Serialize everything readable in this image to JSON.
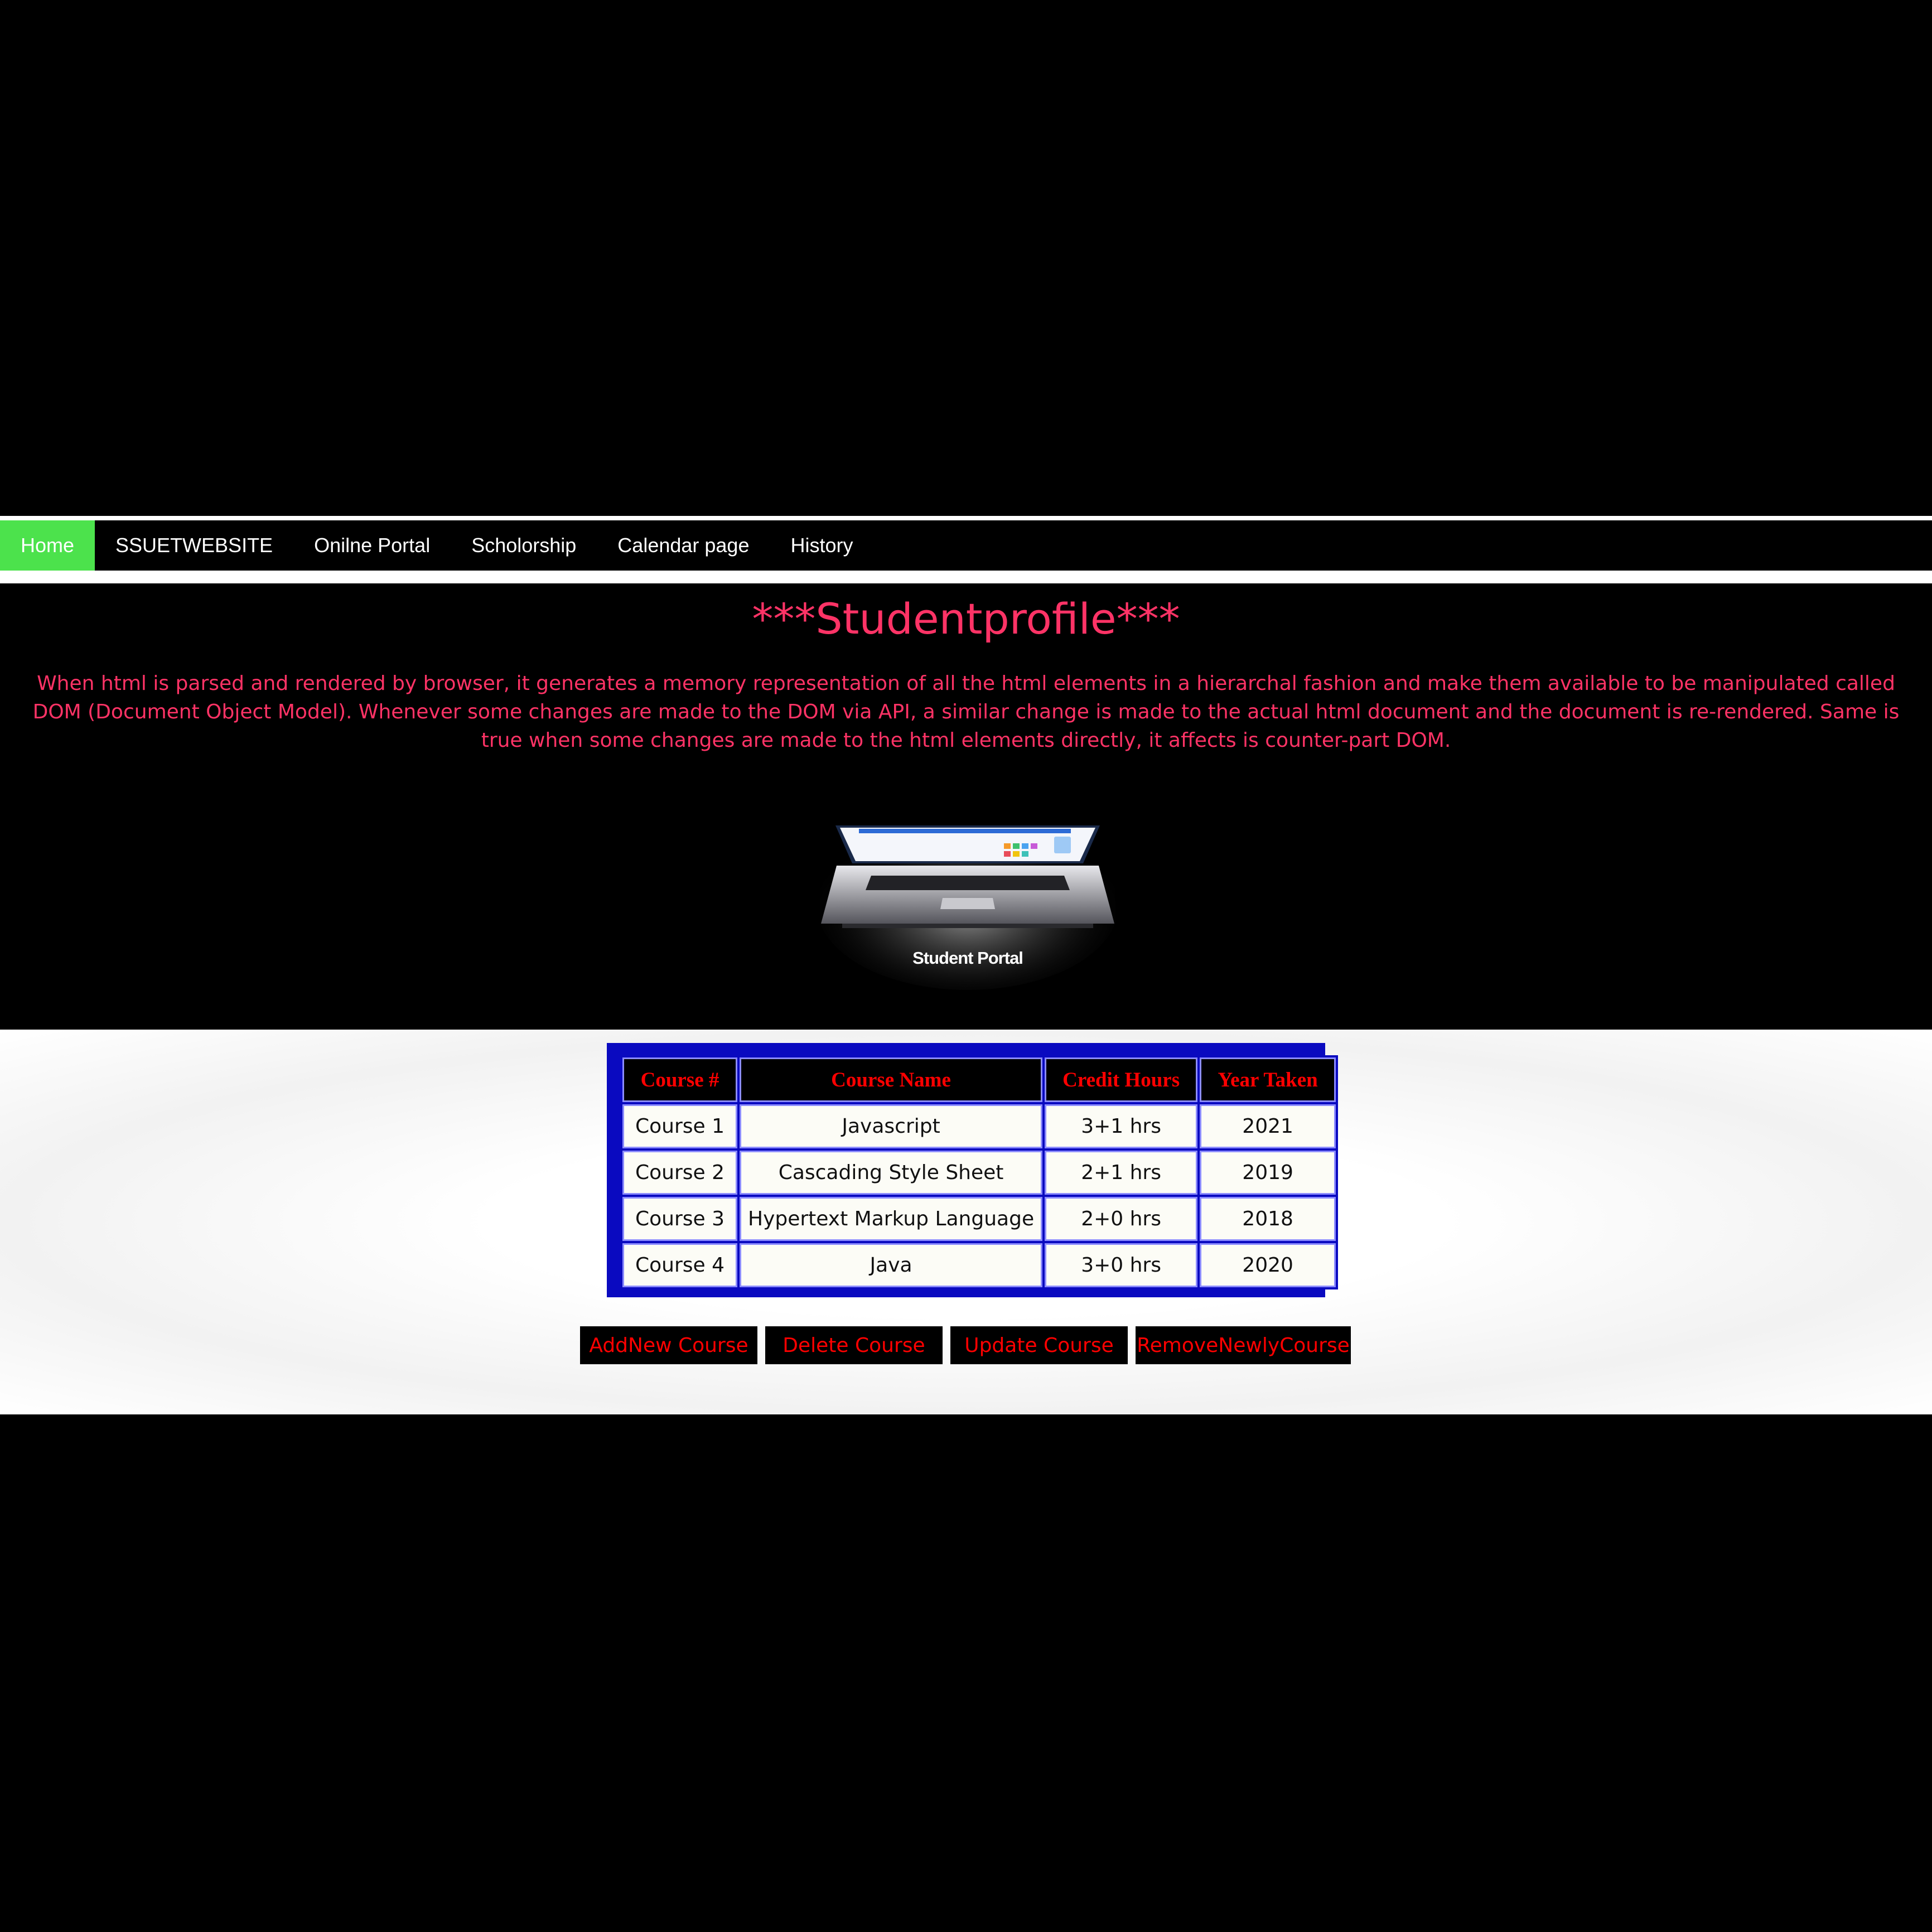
{
  "nav": {
    "items": [
      {
        "label": "Home"
      },
      {
        "label": "SSUETWEBSITE"
      },
      {
        "label": "Onilne Portal"
      },
      {
        "label": "Scholorship"
      },
      {
        "label": "Calendar page"
      },
      {
        "label": "History"
      }
    ]
  },
  "hero": {
    "title": "***Studentprofile***",
    "description": "When html is parsed and rendered by browser, it generates a memory representation of all the html elements in a hierarchal fashion and make them available to be manipulated called DOM (Document Object Model). Whenever some changes are made to the DOM via API, a similar change is made to the actual html document and the document is re-rendered. Same is true when some changes are made to the html elements directly, it affects is counter-part DOM.",
    "image_caption": "Student Portal"
  },
  "table": {
    "headers": [
      "Course #",
      "Course Name",
      "Credit Hours",
      "Year Taken"
    ],
    "rows": [
      [
        "Course 1",
        "Javascript",
        "3+1 hrs",
        "2021"
      ],
      [
        "Course 2",
        "Cascading Style Sheet",
        "2+1 hrs",
        "2019"
      ],
      [
        "Course 3",
        "Hypertext Markup Language",
        "2+0 hrs",
        "2018"
      ],
      [
        "Course 4",
        "Java",
        "3+0 hrs",
        "2020"
      ]
    ]
  },
  "buttons": {
    "add": "AddNew Course",
    "delete": "Delete Course",
    "update": "Update Course",
    "remove": "RemoveNewlyCourse"
  },
  "colors": {
    "nav_active": "#4ce24c",
    "accent_text": "#ff3366",
    "table_border": "#0a0ac0",
    "header_text": "#ff0000"
  },
  "icons": [
    "laptop-image"
  ]
}
